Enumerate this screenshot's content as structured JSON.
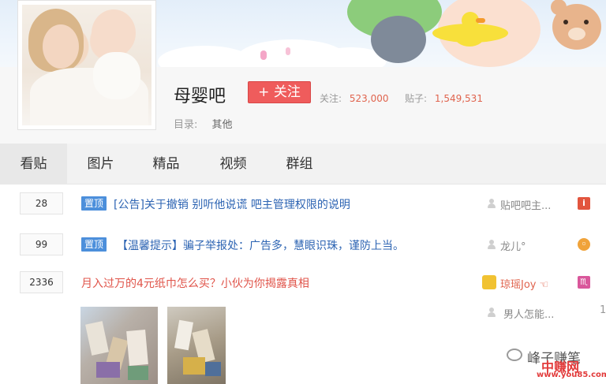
{
  "forum": {
    "name": "母婴吧",
    "follow_label": "+ 关注",
    "followers_label": "关注:",
    "followers_value": "523,000",
    "posts_label": "贴子:",
    "posts_value": "1,549,531",
    "catalog_label": "目录:",
    "catalog_value": "其他"
  },
  "tabs": [
    {
      "label": "看贴",
      "active": true
    },
    {
      "label": "图片",
      "active": false
    },
    {
      "label": "精品",
      "active": false
    },
    {
      "label": "视频",
      "active": false
    },
    {
      "label": "群组",
      "active": false
    }
  ],
  "threads": [
    {
      "replies": "28",
      "pin": "置顶",
      "title": "[公告]关于撤销 别听他说谎 吧主管理权限的说明",
      "author": "贴吧吧主..."
    },
    {
      "replies": "99",
      "pin": "置顶",
      "title": "【温馨提示】骗子举报处：广告多，慧眼识珠，谨防上当。",
      "author": "龙儿°"
    },
    {
      "replies": "2336",
      "title": "月入过万的4元纸巾怎么买？小伙为你揭露真相",
      "author": "琼瑶Joy ☜",
      "last_reply": "男人怎能...",
      "last_num": "1"
    }
  ],
  "watermark": {
    "line1": "峰子赚笔",
    "line2": "中赚网",
    "url": "www.you85.com"
  },
  "colors": {
    "accent_red": "#ef5c5c",
    "pin_blue": "#4c8fdb",
    "link_blue": "#2d64b3",
    "number_orange": "#e0644e"
  }
}
